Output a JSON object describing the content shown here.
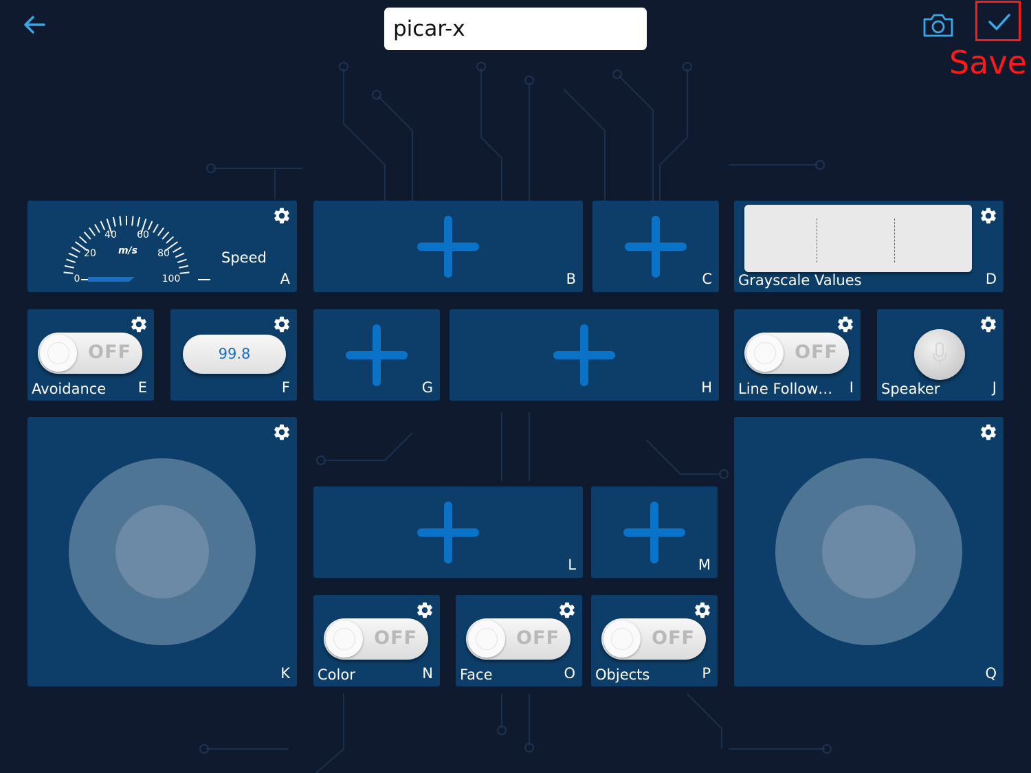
{
  "header": {
    "title_value": "picar-x",
    "save_annotation": "Save",
    "back_icon": "back-arrow-icon",
    "camera_icon": "camera-icon",
    "confirm_icon": "checkmark-icon",
    "accent_color": "#3aa8e6",
    "annotation_color": "#ff1a1a"
  },
  "widgets": {
    "A": {
      "letter": "A",
      "label": "Speed",
      "gauge_unit": "m/s",
      "gauge_ticks": [
        "0",
        "20",
        "40",
        "60",
        "80",
        "100"
      ]
    },
    "B": {
      "letter": "B"
    },
    "C": {
      "letter": "C"
    },
    "D": {
      "letter": "D",
      "label": "Grayscale Values"
    },
    "E": {
      "letter": "E",
      "label": "Avoidance",
      "toggle_state": "OFF"
    },
    "F": {
      "letter": "F",
      "value": "99.8"
    },
    "G": {
      "letter": "G"
    },
    "H": {
      "letter": "H"
    },
    "I": {
      "letter": "I",
      "label": "Line Follow…",
      "toggle_state": "OFF"
    },
    "J": {
      "letter": "J",
      "label": "Speaker"
    },
    "K": {
      "letter": "K"
    },
    "L": {
      "letter": "L"
    },
    "M": {
      "letter": "M"
    },
    "N": {
      "letter": "N",
      "label": "Color",
      "toggle_state": "OFF"
    },
    "O": {
      "letter": "O",
      "label": "Face",
      "toggle_state": "OFF"
    },
    "P": {
      "letter": "P",
      "label": "Objects",
      "toggle_state": "OFF"
    },
    "Q": {
      "letter": "Q"
    }
  },
  "colors": {
    "background": "#0f1a2e",
    "widget": "#0c3e69",
    "plus": "#0a73c8",
    "value_text": "#1a6fc4"
  }
}
